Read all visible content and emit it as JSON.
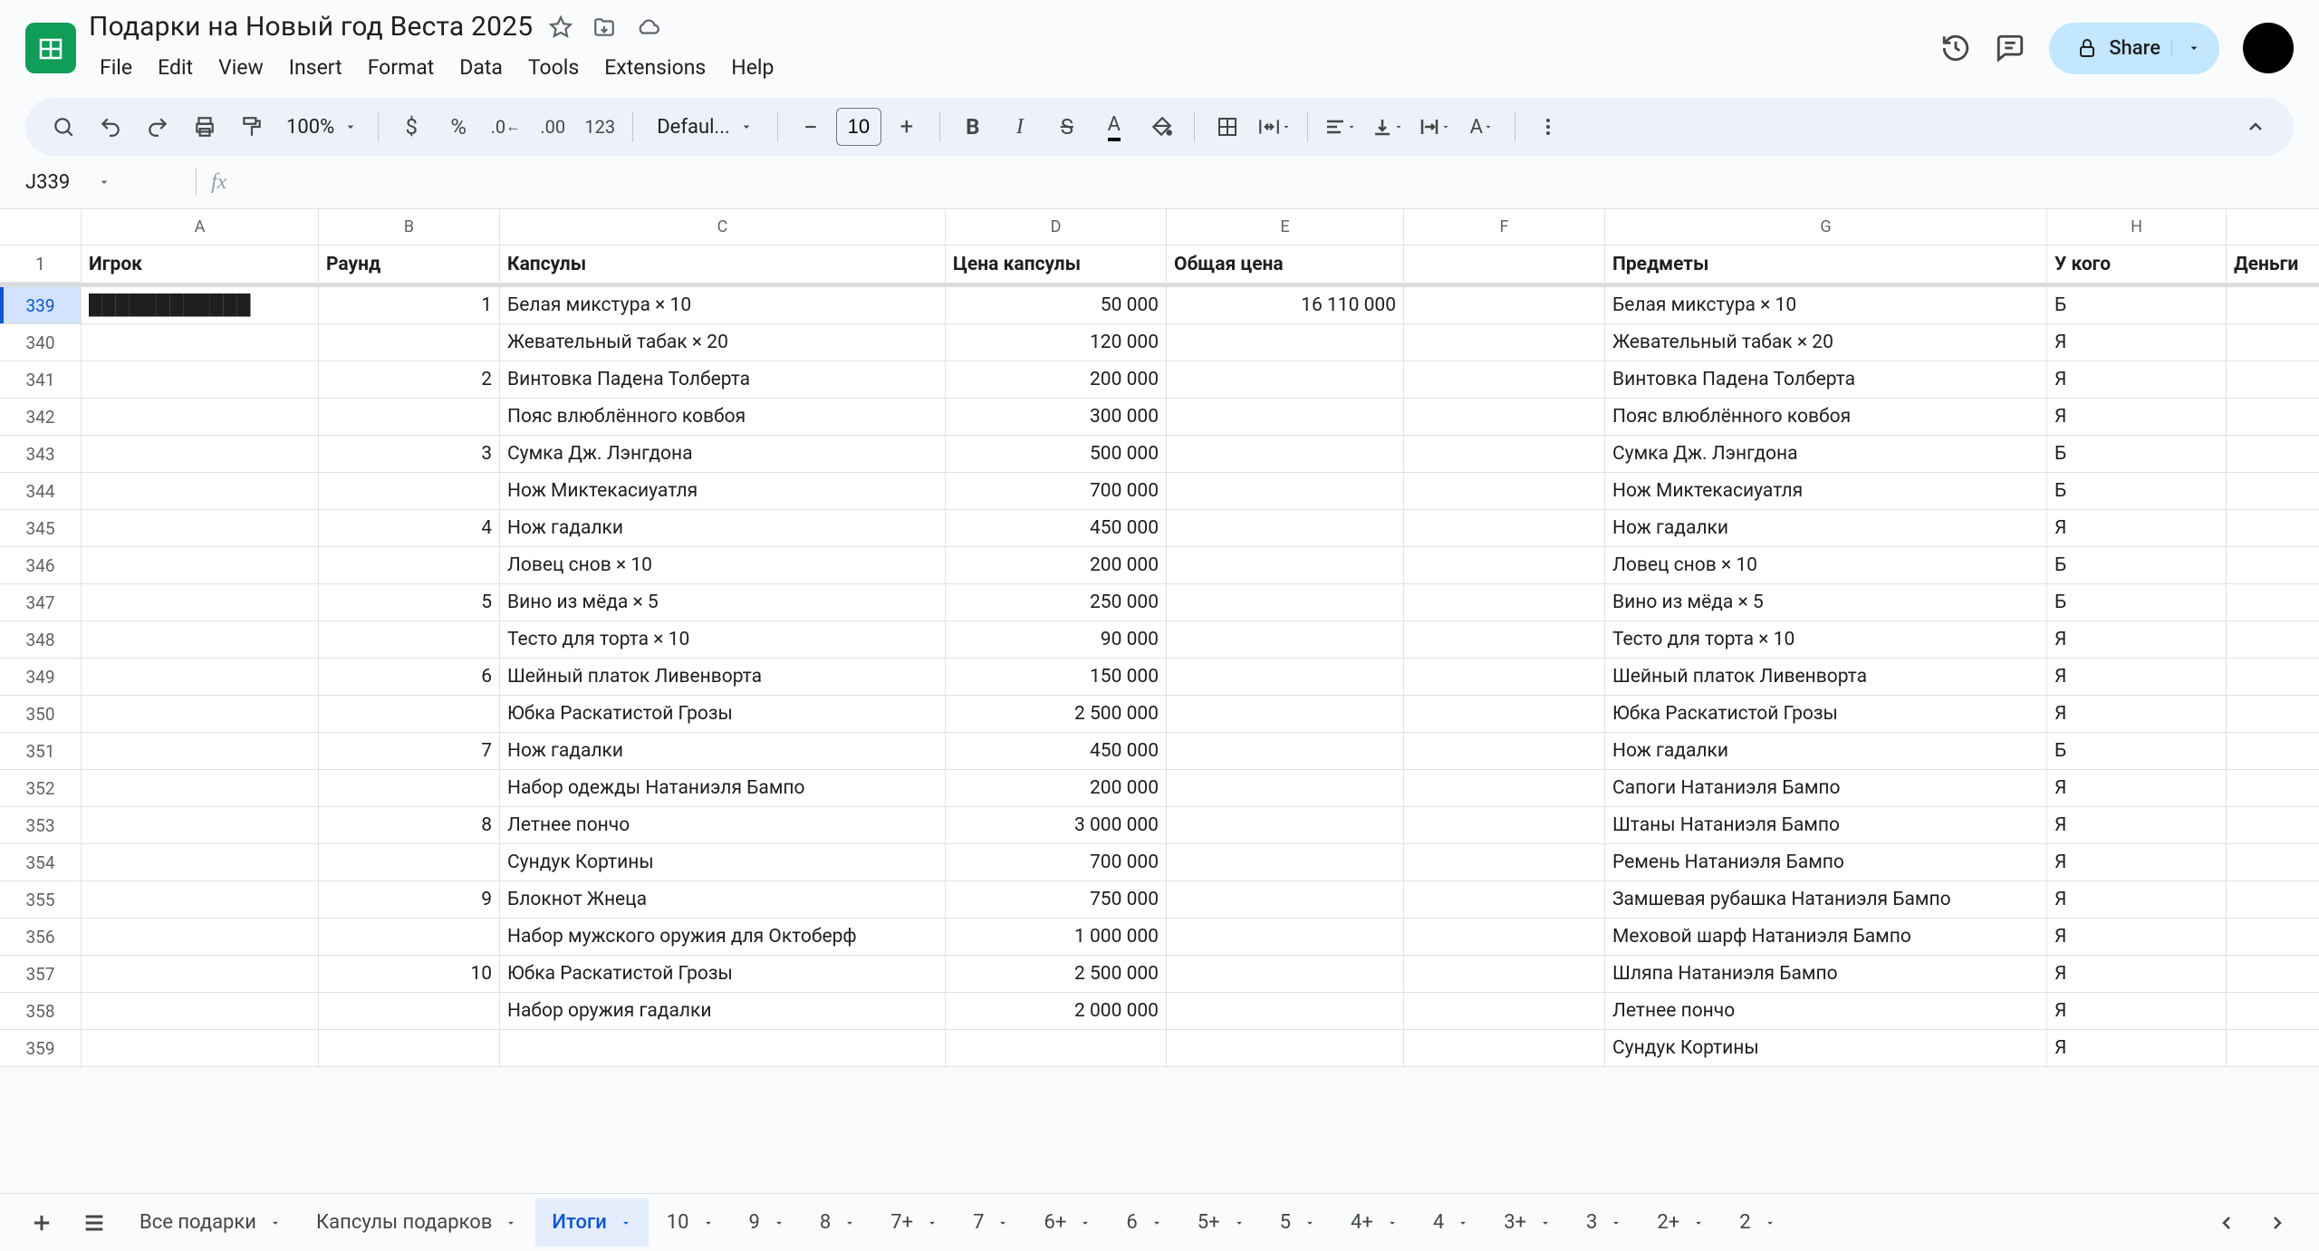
{
  "doc": {
    "title": "Подарки на Новый год Веста 2025"
  },
  "menu": {
    "file": "File",
    "edit": "Edit",
    "view": "View",
    "insert": "Insert",
    "format": "Format",
    "data": "Data",
    "tools": "Tools",
    "extensions": "Extensions",
    "help": "Help"
  },
  "share": {
    "label": "Share"
  },
  "toolbar": {
    "zoom": "100%",
    "font": "Defaul...",
    "size": "10"
  },
  "namebox": {
    "ref": "J339"
  },
  "columns": [
    "A",
    "B",
    "C",
    "D",
    "E",
    "F",
    "G",
    "H"
  ],
  "headers": {
    "A": "Игрок",
    "B": "Раунд",
    "C": "Капсулы",
    "D": "Цена капсулы",
    "E": "Общая цена",
    "F": "",
    "G": "Предметы",
    "H": "У кого",
    "I": "Деньги"
  },
  "frozen_row_num": "1",
  "row_start": 339,
  "rows": [
    {
      "n": "339",
      "A": "████████████",
      "B": "1",
      "C": "Белая микстура × 10",
      "D": "50 000",
      "E": "16 110 000",
      "G": "Белая микстура × 10",
      "H": "Б"
    },
    {
      "n": "340",
      "C": "Жевательный табак × 20",
      "D": "120 000",
      "G": "Жевательный табак × 20",
      "H": "Я"
    },
    {
      "n": "341",
      "B": "2",
      "C": "Винтовка Падена Толберта",
      "D": "200 000",
      "G": "Винтовка Падена Толберта",
      "H": "Я"
    },
    {
      "n": "342",
      "C": "Пояс влюблённого ковбоя",
      "D": "300 000",
      "G": "Пояс влюблённого ковбоя",
      "H": "Я"
    },
    {
      "n": "343",
      "B": "3",
      "C": "Сумка Дж. Лэнгдона",
      "D": "500 000",
      "G": "Сумка Дж. Лэнгдона",
      "H": "Б"
    },
    {
      "n": "344",
      "C": "Нож Миктекасиуатля",
      "D": "700 000",
      "G": "Нож Миктекасиуатля",
      "H": "Б"
    },
    {
      "n": "345",
      "B": "4",
      "C": "Нож гадалки",
      "D": "450 000",
      "G": "Нож гадалки",
      "H": "Я"
    },
    {
      "n": "346",
      "C": "Ловец снов × 10",
      "D": "200 000",
      "G": "Ловец снов × 10",
      "H": "Б"
    },
    {
      "n": "347",
      "B": "5",
      "C": "Вино из мёда × 5",
      "D": "250 000",
      "G": "Вино из мёда × 5",
      "H": "Б"
    },
    {
      "n": "348",
      "C": "Тесто для торта × 10",
      "D": "90 000",
      "G": "Тесто для торта × 10",
      "H": "Я"
    },
    {
      "n": "349",
      "B": "6",
      "C": "Шейный платок Ливенворта",
      "D": "150 000",
      "G": "Шейный платок Ливенворта",
      "H": "Я"
    },
    {
      "n": "350",
      "C": "Юбка Раскатистой Грозы",
      "D": "2 500 000",
      "G": "Юбка Раскатистой Грозы",
      "H": "Я"
    },
    {
      "n": "351",
      "B": "7",
      "C": "Нож гадалки",
      "D": "450 000",
      "G": "Нож гадалки",
      "H": "Б"
    },
    {
      "n": "352",
      "C": "Набор одежды Натаниэля Бампо",
      "D": "200 000",
      "G": "Сапоги Натаниэля Бампо",
      "H": "Я"
    },
    {
      "n": "353",
      "B": "8",
      "C": "Летнее пончо",
      "D": "3 000 000",
      "G": "Штаны Натаниэля Бампо",
      "H": "Я"
    },
    {
      "n": "354",
      "C": "Сундук Кортины",
      "D": "700 000",
      "G": "Ремень Натаниэля Бампо",
      "H": "Я"
    },
    {
      "n": "355",
      "B": "9",
      "C": "Блокнот Жнеца",
      "D": "750 000",
      "G": "Замшевая рубашка Натаниэля Бампо",
      "H": "Я"
    },
    {
      "n": "356",
      "C": "Набор мужского оружия для Октоберф",
      "D": "1 000 000",
      "G": "Меховой шарф Натаниэля Бампо",
      "H": "Я"
    },
    {
      "n": "357",
      "B": "10",
      "C": "Юбка Раскатистой Грозы",
      "D": "2 500 000",
      "G": "Шляпа Натаниэля Бампо",
      "H": "Я"
    },
    {
      "n": "358",
      "C": "Набор оружия гадалки",
      "D": "2 000 000",
      "G": "Летнее пончо",
      "H": "Я"
    },
    {
      "n": "359",
      "G": "Сундук Кортины",
      "H": "Я"
    }
  ],
  "tabs": {
    "list": [
      "Все подарки",
      "Капсулы подарков",
      "Итоги",
      "10",
      "9",
      "8",
      "7+",
      "7",
      "6+",
      "6",
      "5+",
      "5",
      "4+",
      "4",
      "3+",
      "3",
      "2+",
      "2"
    ],
    "active": "Итоги"
  }
}
